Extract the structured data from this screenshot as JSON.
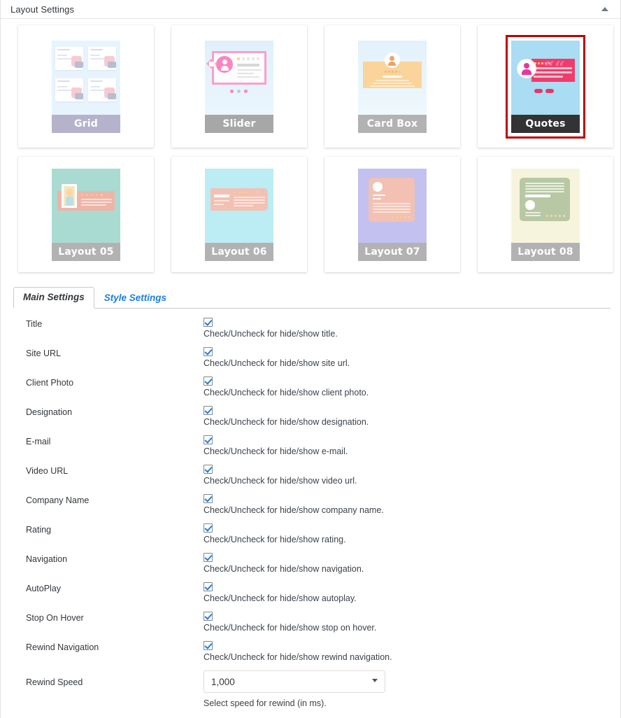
{
  "header": {
    "title": "Layout Settings",
    "toggle_icon": "collapse-triangle-up-icon"
  },
  "layouts": [
    {
      "id": "grid",
      "label": "Grid",
      "selected": false,
      "bg": "#e8f4fd",
      "label_bg": "#b5b3cb",
      "accent": "#f3c8cd"
    },
    {
      "id": "slider",
      "label": "Slider",
      "selected": false,
      "bg": "#e4f2fb",
      "label_bg": "#a7a7a7",
      "accent": "#ff9ec9"
    },
    {
      "id": "card-box",
      "label": "Card Box",
      "selected": false,
      "bg": "#e2f1fb",
      "label_bg": "#b2b2b2",
      "accent": "#fcd79a"
    },
    {
      "id": "quotes",
      "label": "Quotes",
      "selected": true,
      "bg": "#aadcf3",
      "label_bg": "#333333",
      "accent": "#f23b6c",
      "selected_border_color": "#c00000"
    },
    {
      "id": "layout-05",
      "label": "Layout 05",
      "selected": false,
      "bg": "#aadbd3",
      "label_bg": "#b2b2b2",
      "accent": "#eeb4a8"
    },
    {
      "id": "layout-06",
      "label": "Layout 06",
      "selected": false,
      "bg": "#bcecf4",
      "label_bg": "#b2b2b2",
      "accent": "#f2c1b3"
    },
    {
      "id": "layout-07",
      "label": "Layout 07",
      "selected": false,
      "bg": "#c3c1ef",
      "label_bg": "#b2b2b2",
      "accent": "#f2c1b3"
    },
    {
      "id": "layout-08",
      "label": "Layout 08",
      "selected": false,
      "bg": "#f7f4dd",
      "label_bg": "#b2b2b2",
      "accent": "#b8c8a5"
    }
  ],
  "tabs": [
    {
      "label": "Main Settings",
      "active": true
    },
    {
      "label": "Style Settings",
      "active": false
    }
  ],
  "settings": {
    "rows": [
      {
        "label": "Title",
        "checked": true,
        "help": "Check/Uncheck for hide/show title."
      },
      {
        "label": "Site URL",
        "checked": true,
        "help": "Check/Uncheck for hide/show site url."
      },
      {
        "label": "Client Photo",
        "checked": true,
        "help": "Check/Uncheck for hide/show client photo."
      },
      {
        "label": "Designation",
        "checked": true,
        "help": "Check/Uncheck for hide/show designation."
      },
      {
        "label": "E-mail",
        "checked": true,
        "help": "Check/Uncheck for hide/show e-mail."
      },
      {
        "label": "Video URL",
        "checked": true,
        "help": "Check/Uncheck for hide/show video url."
      },
      {
        "label": "Company Name",
        "checked": true,
        "help": "Check/Uncheck for hide/show company name."
      },
      {
        "label": "Rating",
        "checked": true,
        "help": "Check/Uncheck for hide/show rating."
      },
      {
        "label": "Navigation",
        "checked": true,
        "help": "Check/Uncheck for hide/show navigation."
      },
      {
        "label": "AutoPlay",
        "checked": true,
        "help": "Check/Uncheck for hide/show autoplay."
      },
      {
        "label": "Stop On Hover",
        "checked": true,
        "help": "Check/Uncheck for hide/show stop on hover."
      },
      {
        "label": "Rewind Navigation",
        "checked": true,
        "help": "Check/Uncheck for hide/show rewind navigation."
      }
    ],
    "rewind_speed": {
      "label": "Rewind Speed",
      "value": "1,000",
      "options": [
        "1,000"
      ],
      "help": "Select speed for rewind (in ms)."
    }
  }
}
